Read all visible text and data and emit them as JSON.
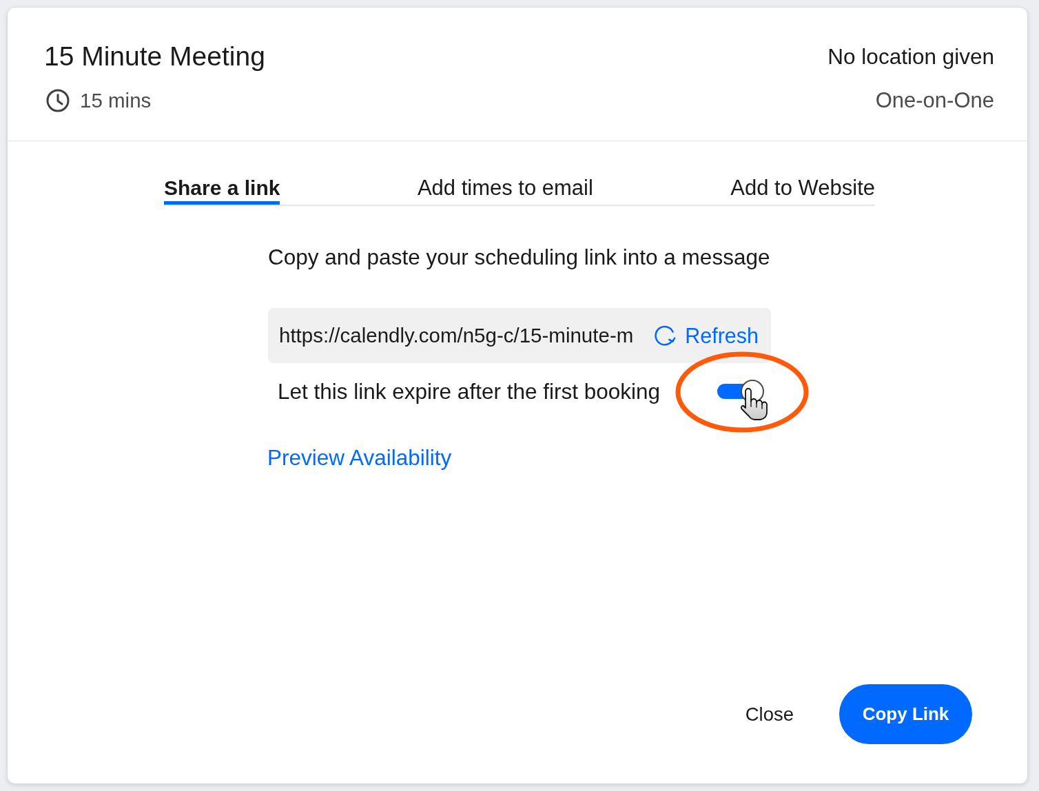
{
  "meeting": {
    "title": "15 Minute Meeting",
    "duration": "15 mins",
    "location": "No location given",
    "event_type": "One-on-One"
  },
  "tabs": [
    {
      "label": "Share a link",
      "selected": true
    },
    {
      "label": "Add times to email",
      "selected": false
    },
    {
      "label": "Add to Website",
      "selected": false
    }
  ],
  "share": {
    "instruction": "Copy and paste your scheduling link into a message",
    "link": "https://calendly.com/n5g-c/15-minute-m",
    "refresh": "Refresh",
    "expire": {
      "label": "Let this link expire after the first booking",
      "on": true
    },
    "preview": "Preview Availability"
  },
  "buttons": [
    {
      "label": "Close",
      "kind": "plain"
    },
    {
      "label": "Copy Link",
      "kind": "primary"
    }
  ]
}
